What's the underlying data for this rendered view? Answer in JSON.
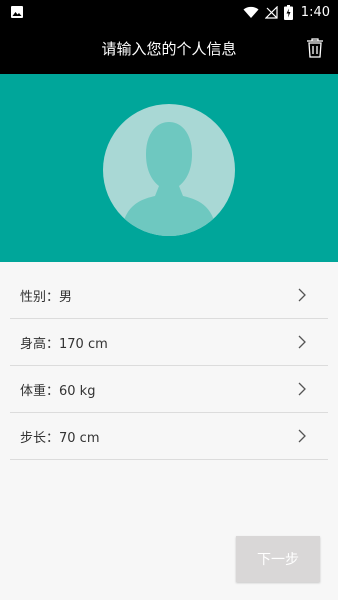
{
  "status_bar": {
    "time": "1:40",
    "icons": [
      "image-icon",
      "wifi-icon",
      "no-signal-icon",
      "battery-charging-icon"
    ]
  },
  "app_bar": {
    "title": "请输入您的个人信息",
    "trash_icon": "trash-icon"
  },
  "hero": {
    "avatar_icon": "default-avatar-icon",
    "accent_color": "#00a69a"
  },
  "list": {
    "items": [
      {
        "label": "性别：男"
      },
      {
        "label": "身高：170 cm"
      },
      {
        "label": "体重：60 kg"
      },
      {
        "label": "步长：70 cm"
      }
    ]
  },
  "next_button": {
    "label": "下一步"
  }
}
